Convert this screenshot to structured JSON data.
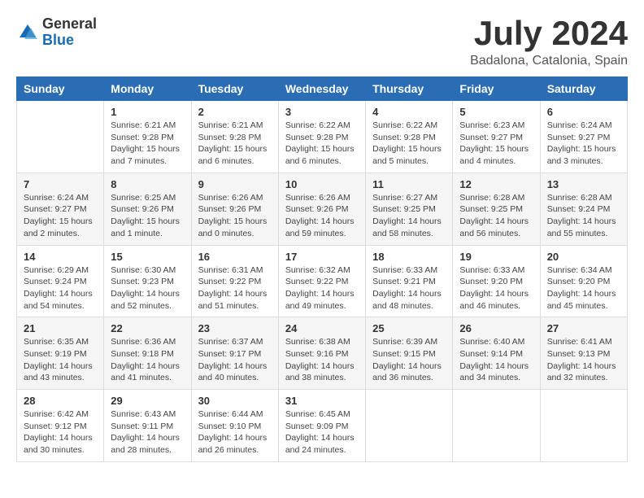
{
  "header": {
    "logo_general": "General",
    "logo_blue": "Blue",
    "month_title": "July 2024",
    "subtitle": "Badalona, Catalonia, Spain"
  },
  "weekdays": [
    "Sunday",
    "Monday",
    "Tuesday",
    "Wednesday",
    "Thursday",
    "Friday",
    "Saturday"
  ],
  "weeks": [
    [
      {
        "day": "",
        "info": ""
      },
      {
        "day": "1",
        "info": "Sunrise: 6:21 AM\nSunset: 9:28 PM\nDaylight: 15 hours\nand 7 minutes."
      },
      {
        "day": "2",
        "info": "Sunrise: 6:21 AM\nSunset: 9:28 PM\nDaylight: 15 hours\nand 6 minutes."
      },
      {
        "day": "3",
        "info": "Sunrise: 6:22 AM\nSunset: 9:28 PM\nDaylight: 15 hours\nand 6 minutes."
      },
      {
        "day": "4",
        "info": "Sunrise: 6:22 AM\nSunset: 9:28 PM\nDaylight: 15 hours\nand 5 minutes."
      },
      {
        "day": "5",
        "info": "Sunrise: 6:23 AM\nSunset: 9:27 PM\nDaylight: 15 hours\nand 4 minutes."
      },
      {
        "day": "6",
        "info": "Sunrise: 6:24 AM\nSunset: 9:27 PM\nDaylight: 15 hours\nand 3 minutes."
      }
    ],
    [
      {
        "day": "7",
        "info": "Sunrise: 6:24 AM\nSunset: 9:27 PM\nDaylight: 15 hours\nand 2 minutes."
      },
      {
        "day": "8",
        "info": "Sunrise: 6:25 AM\nSunset: 9:26 PM\nDaylight: 15 hours\nand 1 minute."
      },
      {
        "day": "9",
        "info": "Sunrise: 6:26 AM\nSunset: 9:26 PM\nDaylight: 15 hours\nand 0 minutes."
      },
      {
        "day": "10",
        "info": "Sunrise: 6:26 AM\nSunset: 9:26 PM\nDaylight: 14 hours\nand 59 minutes."
      },
      {
        "day": "11",
        "info": "Sunrise: 6:27 AM\nSunset: 9:25 PM\nDaylight: 14 hours\nand 58 minutes."
      },
      {
        "day": "12",
        "info": "Sunrise: 6:28 AM\nSunset: 9:25 PM\nDaylight: 14 hours\nand 56 minutes."
      },
      {
        "day": "13",
        "info": "Sunrise: 6:28 AM\nSunset: 9:24 PM\nDaylight: 14 hours\nand 55 minutes."
      }
    ],
    [
      {
        "day": "14",
        "info": "Sunrise: 6:29 AM\nSunset: 9:24 PM\nDaylight: 14 hours\nand 54 minutes."
      },
      {
        "day": "15",
        "info": "Sunrise: 6:30 AM\nSunset: 9:23 PM\nDaylight: 14 hours\nand 52 minutes."
      },
      {
        "day": "16",
        "info": "Sunrise: 6:31 AM\nSunset: 9:22 PM\nDaylight: 14 hours\nand 51 minutes."
      },
      {
        "day": "17",
        "info": "Sunrise: 6:32 AM\nSunset: 9:22 PM\nDaylight: 14 hours\nand 49 minutes."
      },
      {
        "day": "18",
        "info": "Sunrise: 6:33 AM\nSunset: 9:21 PM\nDaylight: 14 hours\nand 48 minutes."
      },
      {
        "day": "19",
        "info": "Sunrise: 6:33 AM\nSunset: 9:20 PM\nDaylight: 14 hours\nand 46 minutes."
      },
      {
        "day": "20",
        "info": "Sunrise: 6:34 AM\nSunset: 9:20 PM\nDaylight: 14 hours\nand 45 minutes."
      }
    ],
    [
      {
        "day": "21",
        "info": "Sunrise: 6:35 AM\nSunset: 9:19 PM\nDaylight: 14 hours\nand 43 minutes."
      },
      {
        "day": "22",
        "info": "Sunrise: 6:36 AM\nSunset: 9:18 PM\nDaylight: 14 hours\nand 41 minutes."
      },
      {
        "day": "23",
        "info": "Sunrise: 6:37 AM\nSunset: 9:17 PM\nDaylight: 14 hours\nand 40 minutes."
      },
      {
        "day": "24",
        "info": "Sunrise: 6:38 AM\nSunset: 9:16 PM\nDaylight: 14 hours\nand 38 minutes."
      },
      {
        "day": "25",
        "info": "Sunrise: 6:39 AM\nSunset: 9:15 PM\nDaylight: 14 hours\nand 36 minutes."
      },
      {
        "day": "26",
        "info": "Sunrise: 6:40 AM\nSunset: 9:14 PM\nDaylight: 14 hours\nand 34 minutes."
      },
      {
        "day": "27",
        "info": "Sunrise: 6:41 AM\nSunset: 9:13 PM\nDaylight: 14 hours\nand 32 minutes."
      }
    ],
    [
      {
        "day": "28",
        "info": "Sunrise: 6:42 AM\nSunset: 9:12 PM\nDaylight: 14 hours\nand 30 minutes."
      },
      {
        "day": "29",
        "info": "Sunrise: 6:43 AM\nSunset: 9:11 PM\nDaylight: 14 hours\nand 28 minutes."
      },
      {
        "day": "30",
        "info": "Sunrise: 6:44 AM\nSunset: 9:10 PM\nDaylight: 14 hours\nand 26 minutes."
      },
      {
        "day": "31",
        "info": "Sunrise: 6:45 AM\nSunset: 9:09 PM\nDaylight: 14 hours\nand 24 minutes."
      },
      {
        "day": "",
        "info": ""
      },
      {
        "day": "",
        "info": ""
      },
      {
        "day": "",
        "info": ""
      }
    ]
  ]
}
